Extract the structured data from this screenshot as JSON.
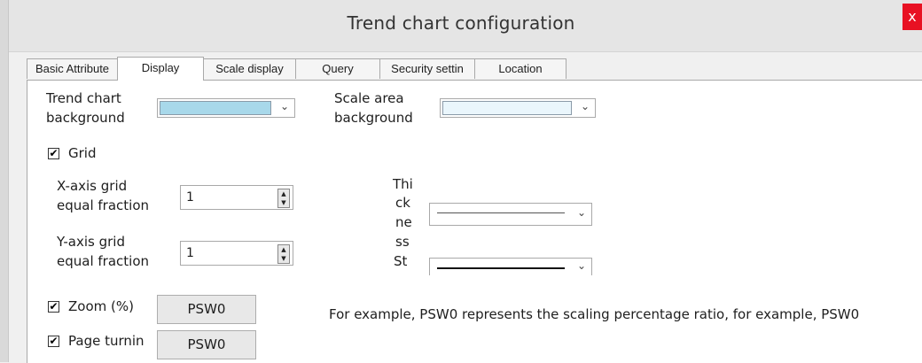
{
  "window": {
    "title": "Trend chart configuration",
    "close": "x"
  },
  "tabs": [
    {
      "label": "Basic Attribute"
    },
    {
      "label": "Display"
    },
    {
      "label": "Scale display"
    },
    {
      "label": "Query"
    },
    {
      "label": "Security settin"
    },
    {
      "label": "Location"
    }
  ],
  "display": {
    "trend_bg_label_1": "Trend chart",
    "trend_bg_label_2": "background",
    "trend_bg_color": "#a8d8ea",
    "scale_bg_label_1": "Scale area",
    "scale_bg_label_2": "background",
    "scale_bg_color": "#eaf6fc",
    "combo_arrow": "⌄",
    "grid": {
      "label": "Grid",
      "checked": true
    },
    "x_grid": {
      "label_1": "X-axis grid",
      "label_2": "equal fraction",
      "value": "1"
    },
    "y_grid": {
      "label_1": "Y-axis grid",
      "label_2": "equal fraction",
      "value": "1"
    },
    "thickness_label": [
      "Thi",
      "ck",
      "ne",
      "ss"
    ],
    "style_label": "St",
    "zoom": {
      "label": "Zoom (%)",
      "checked": true,
      "button": "PSW0"
    },
    "page_turning": {
      "label": "Page turnin",
      "checked": true,
      "button": "PSW0"
    },
    "example_text": "For example, PSW0 represents the scaling percentage ratio, for example, PSW0"
  }
}
